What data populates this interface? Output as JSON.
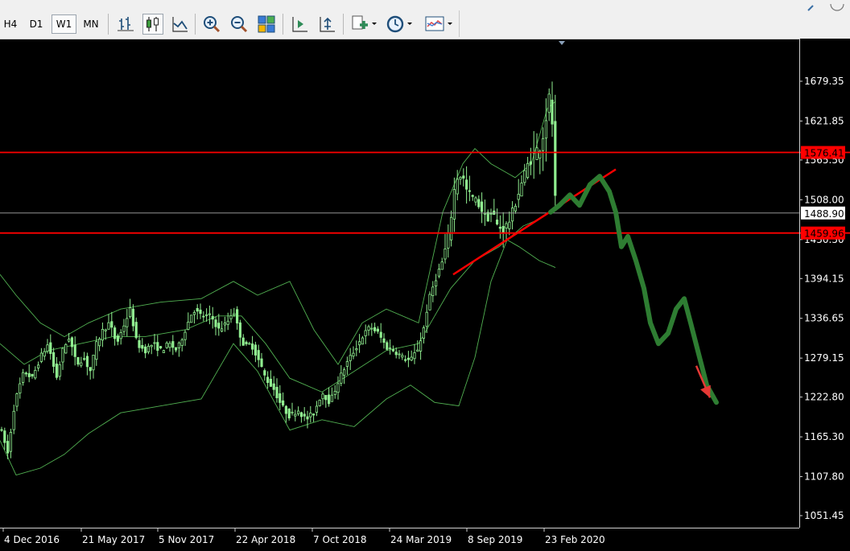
{
  "toolbar": {
    "timeframes": [
      {
        "label": "H4",
        "active": false
      },
      {
        "label": "D1",
        "active": false
      },
      {
        "label": "W1",
        "active": true
      },
      {
        "label": "MN",
        "active": false
      }
    ],
    "icons": [
      "bar-chart-icon",
      "candlestick-chart-icon",
      "line-chart-icon",
      "zoom-in-icon",
      "zoom-out-icon",
      "tile-windows-icon",
      "chart-shift-icon",
      "autoscroll-icon",
      "new-chart-icon",
      "periods-clock-icon",
      "templates-icon"
    ]
  },
  "colors": {
    "background": "#000000",
    "candle": "#90ee90",
    "bands": "#5fcf5f",
    "level_line": "#ff0000",
    "price_line": "#aaaaaa",
    "forecast": "#2e7d32",
    "arrow": "#e53935",
    "axis_text": "#ffffff"
  },
  "chart_data": {
    "type": "line",
    "series_kind": "candlestick-weekly",
    "yticks": [
      "1679.35",
      "1621.85",
      "1565.50",
      "1508.00",
      "1450.50",
      "1394.15",
      "1336.65",
      "1279.15",
      "1222.80",
      "1165.30",
      "1107.80",
      "1051.45"
    ],
    "ylim": [
      1020,
      1725
    ],
    "xticks": [
      "4 Dec 2016",
      "21 May 2017",
      "5 Nov 2017",
      "22 Apr 2018",
      "7 Oct 2018",
      "24 Mar 2019",
      "8 Sep 2019",
      "23 Feb 2020"
    ],
    "price_line": {
      "value": 1488.9,
      "label": "1488.90"
    },
    "levels": [
      {
        "value": 1576.41,
        "label": "1576.41"
      },
      {
        "value": 1459.96,
        "label": "1459.96"
      }
    ],
    "close_path": [
      [
        0,
        1180
      ],
      [
        5,
        1160
      ],
      [
        10,
        1140
      ],
      [
        16,
        1200
      ],
      [
        22,
        1230
      ],
      [
        30,
        1260
      ],
      [
        40,
        1250
      ],
      [
        50,
        1280
      ],
      [
        60,
        1300
      ],
      [
        70,
        1250
      ],
      [
        78,
        1290
      ],
      [
        86,
        1310
      ],
      [
        95,
        1270
      ],
      [
        104,
        1280
      ],
      [
        112,
        1260
      ],
      [
        120,
        1300
      ],
      [
        128,
        1320
      ],
      [
        136,
        1330
      ],
      [
        145,
        1300
      ],
      [
        155,
        1330
      ],
      [
        162,
        1350
      ],
      [
        170,
        1300
      ],
      [
        180,
        1290
      ],
      [
        190,
        1300
      ],
      [
        200,
        1290
      ],
      [
        210,
        1300
      ],
      [
        220,
        1290
      ],
      [
        230,
        1320
      ],
      [
        240,
        1350
      ],
      [
        250,
        1340
      ],
      [
        262,
        1340
      ],
      [
        272,
        1320
      ],
      [
        282,
        1330
      ],
      [
        290,
        1350
      ],
      [
        296,
        1320
      ],
      [
        304,
        1295
      ],
      [
        312,
        1300
      ],
      [
        320,
        1280
      ],
      [
        330,
        1250
      ],
      [
        340,
        1235
      ],
      [
        350,
        1210
      ],
      [
        360,
        1195
      ],
      [
        370,
        1205
      ],
      [
        380,
        1190
      ],
      [
        390,
        1200
      ],
      [
        400,
        1230
      ],
      [
        410,
        1215
      ],
      [
        420,
        1245
      ],
      [
        430,
        1270
      ],
      [
        440,
        1290
      ],
      [
        450,
        1310
      ],
      [
        460,
        1325
      ],
      [
        470,
        1315
      ],
      [
        480,
        1295
      ],
      [
        490,
        1290
      ],
      [
        500,
        1280
      ],
      [
        510,
        1275
      ],
      [
        520,
        1295
      ],
      [
        526,
        1320
      ],
      [
        532,
        1360
      ],
      [
        540,
        1390
      ],
      [
        550,
        1420
      ],
      [
        558,
        1460
      ],
      [
        564,
        1520
      ],
      [
        568,
        1540
      ],
      [
        574,
        1545
      ],
      [
        580,
        1520
      ],
      [
        588,
        1510
      ],
      [
        596,
        1500
      ],
      [
        604,
        1480
      ],
      [
        612,
        1490
      ],
      [
        618,
        1470
      ],
      [
        626,
        1465
      ],
      [
        634,
        1480
      ],
      [
        642,
        1510
      ],
      [
        650,
        1540
      ],
      [
        656,
        1560
      ],
      [
        662,
        1570
      ],
      [
        668,
        1580
      ],
      [
        674,
        1600
      ],
      [
        680,
        1640
      ],
      [
        684,
        1660
      ],
      [
        687,
        1600
      ],
      [
        689,
        1520
      ],
      [
        690,
        1500
      ]
    ],
    "bands": {
      "mid": [
        [
          0,
          1300
        ],
        [
          30,
          1270
        ],
        [
          60,
          1290
        ],
        [
          100,
          1300
        ],
        [
          140,
          1310
        ],
        [
          180,
          1310
        ],
        [
          230,
          1320
        ],
        [
          270,
          1340
        ],
        [
          300,
          1340
        ],
        [
          330,
          1300
        ],
        [
          360,
          1250
        ],
        [
          400,
          1230
        ],
        [
          440,
          1260
        ],
        [
          480,
          1290
        ],
        [
          520,
          1300
        ],
        [
          540,
          1340
        ],
        [
          560,
          1380
        ],
        [
          590,
          1420
        ],
        [
          620,
          1440
        ],
        [
          650,
          1470
        ],
        [
          670,
          1480
        ],
        [
          690,
          1495
        ]
      ],
      "upper": [
        [
          0,
          1400
        ],
        [
          20,
          1370
        ],
        [
          50,
          1330
        ],
        [
          80,
          1310
        ],
        [
          110,
          1330
        ],
        [
          150,
          1350
        ],
        [
          200,
          1360
        ],
        [
          250,
          1365
        ],
        [
          290,
          1390
        ],
        [
          320,
          1370
        ],
        [
          360,
          1390
        ],
        [
          390,
          1320
        ],
        [
          420,
          1270
        ],
        [
          450,
          1330
        ],
        [
          480,
          1350
        ],
        [
          520,
          1330
        ],
        [
          550,
          1490
        ],
        [
          575,
          1560
        ],
        [
          590,
          1582
        ],
        [
          610,
          1560
        ],
        [
          640,
          1540
        ],
        [
          660,
          1560
        ],
        [
          680,
          1640
        ],
        [
          690,
          1650
        ]
      ],
      "lower": [
        [
          0,
          1160
        ],
        [
          20,
          1110
        ],
        [
          50,
          1120
        ],
        [
          80,
          1140
        ],
        [
          110,
          1170
        ],
        [
          150,
          1200
        ],
        [
          200,
          1210
        ],
        [
          250,
          1220
        ],
        [
          290,
          1300
        ],
        [
          320,
          1260
        ],
        [
          360,
          1175
        ],
        [
          400,
          1190
        ],
        [
          440,
          1180
        ],
        [
          480,
          1220
        ],
        [
          510,
          1240
        ],
        [
          540,
          1215
        ],
        [
          570,
          1210
        ],
        [
          590,
          1280
        ],
        [
          610,
          1390
        ],
        [
          630,
          1450
        ],
        [
          645,
          1440
        ],
        [
          670,
          1420
        ],
        [
          690,
          1410
        ]
      ]
    },
    "trendline": [
      [
        563,
        1400
      ],
      [
        765,
        1552
      ]
    ],
    "forecast_path": [
      [
        684,
        1490
      ],
      [
        695,
        1500
      ],
      [
        708,
        1515
      ],
      [
        720,
        1500
      ],
      [
        733,
        1530
      ],
      [
        745,
        1542
      ],
      [
        757,
        1520
      ],
      [
        765,
        1490
      ],
      [
        772,
        1440
      ],
      [
        780,
        1455
      ],
      [
        790,
        1420
      ],
      [
        800,
        1380
      ],
      [
        808,
        1330
      ],
      [
        818,
        1300
      ],
      [
        830,
        1315
      ],
      [
        840,
        1350
      ],
      [
        850,
        1365
      ],
      [
        858,
        1330
      ],
      [
        868,
        1285
      ],
      [
        878,
        1240
      ],
      [
        890,
        1215
      ]
    ],
    "arrow": {
      "from": [
        865,
        1268
      ],
      "to": [
        882,
        1222
      ]
    }
  }
}
